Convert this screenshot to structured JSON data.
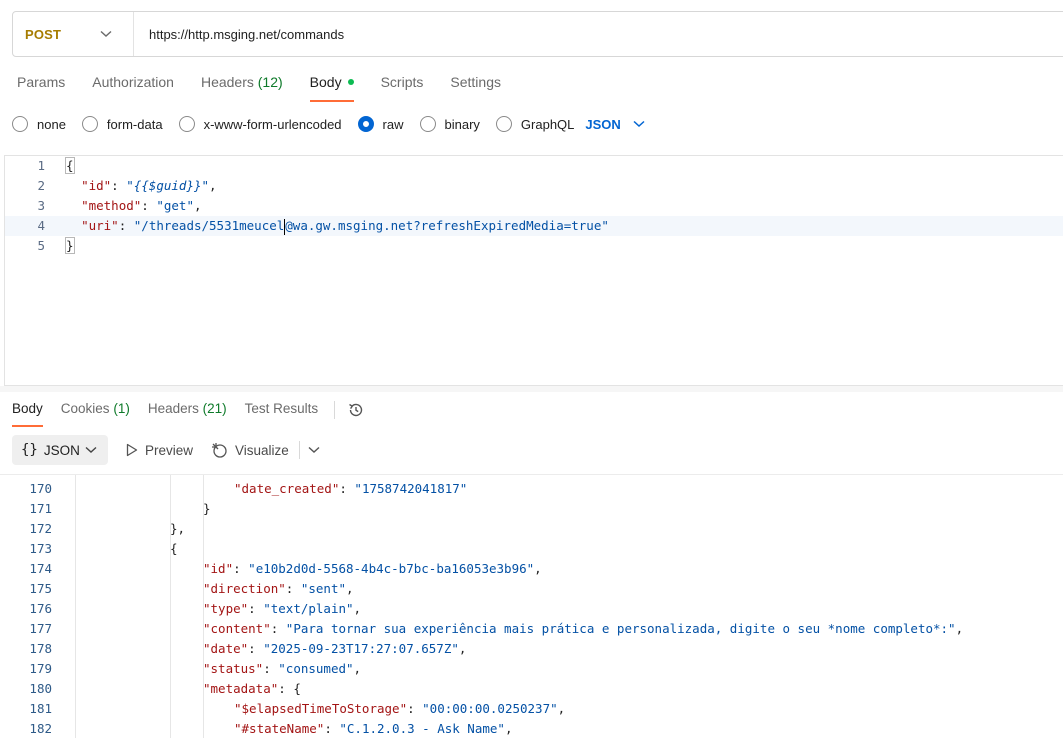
{
  "request": {
    "method": "POST",
    "url": "https://http.msging.net/commands"
  },
  "request_tabs": [
    {
      "label": "Params"
    },
    {
      "label": "Authorization"
    },
    {
      "label": "Headers",
      "count": "(12)"
    },
    {
      "label": "Body",
      "active": true
    },
    {
      "label": "Scripts"
    },
    {
      "label": "Settings"
    }
  ],
  "body_modes": [
    {
      "label": "none"
    },
    {
      "label": "form-data"
    },
    {
      "label": "x-www-form-urlencoded"
    },
    {
      "label": "raw",
      "checked": true
    },
    {
      "label": "binary"
    },
    {
      "label": "GraphQL"
    }
  ],
  "body_format": "JSON",
  "editor": {
    "lines": [
      {
        "n": "1",
        "open": "{"
      },
      {
        "n": "2",
        "key": "\"id\"",
        "value": "\"{{$guid}}\""
      },
      {
        "n": "3",
        "key": "\"method\"",
        "value": "\"get\""
      },
      {
        "n": "4",
        "key": "\"uri\"",
        "value_a": "\"/threads/5531meucel",
        "value_b": "@wa.gw.msging.net?refreshExpiredMedia=true\""
      },
      {
        "n": "5",
        "close": "}"
      }
    ]
  },
  "response_tabs": [
    {
      "label": "Body",
      "active": true
    },
    {
      "label": "Cookies",
      "count": "(1)"
    },
    {
      "label": "Headers",
      "count": "(21)"
    },
    {
      "label": "Test Results"
    }
  ],
  "response_toolbar": {
    "format": "JSON",
    "preview": "Preview",
    "visualize": "Visualize"
  },
  "response_lines": [
    {
      "n": "170",
      "indent": 5,
      "key": "\"date_created\"",
      "value": "\"1758742041817\""
    },
    {
      "n": "171",
      "indent": 4,
      "punct": "}"
    },
    {
      "n": "172",
      "indent": 3,
      "punct": "},"
    },
    {
      "n": "173",
      "indent": 3,
      "punct": "{"
    },
    {
      "n": "174",
      "indent": 4,
      "key": "\"id\"",
      "value": "\"e10b2d0d-5568-4b4c-b7bc-ba16053e3b96\"",
      "comma": true
    },
    {
      "n": "175",
      "indent": 4,
      "key": "\"direction\"",
      "value": "\"sent\"",
      "comma": true
    },
    {
      "n": "176",
      "indent": 4,
      "key": "\"type\"",
      "value": "\"text/plain\"",
      "comma": true
    },
    {
      "n": "177",
      "indent": 4,
      "key": "\"content\"",
      "value": "\"Para tornar sua experiência mais prática e personalizada, digite o seu *nome completo*:\"",
      "comma": true
    },
    {
      "n": "178",
      "indent": 4,
      "key": "\"date\"",
      "value": "\"2025-09-23T17:27:07.657Z\"",
      "comma": true
    },
    {
      "n": "179",
      "indent": 4,
      "key": "\"status\"",
      "value": "\"consumed\"",
      "comma": true
    },
    {
      "n": "180",
      "indent": 4,
      "key": "\"metadata\"",
      "value": "{",
      "brace": true
    },
    {
      "n": "181",
      "indent": 5,
      "key": "\"$elapsedTimeToStorage\"",
      "value": "\"00:00:00.0250237\"",
      "comma": true
    },
    {
      "n": "182",
      "indent": 5,
      "key": "\"#stateName\"",
      "value": "\"C.1.2.0.3 - Ask Name\"",
      "comma": true
    }
  ],
  "icons": {
    "history": "history-icon",
    "preview": "play-icon",
    "visualize": "visualize-icon",
    "dropdown": "chevron-down-icon"
  },
  "colors": {
    "method": "#a67c00",
    "accent": "#ff6c37",
    "link": "#0265d2",
    "count": "#0e7a2a",
    "json_key": "#a31515",
    "json_string": "#0451a5"
  }
}
